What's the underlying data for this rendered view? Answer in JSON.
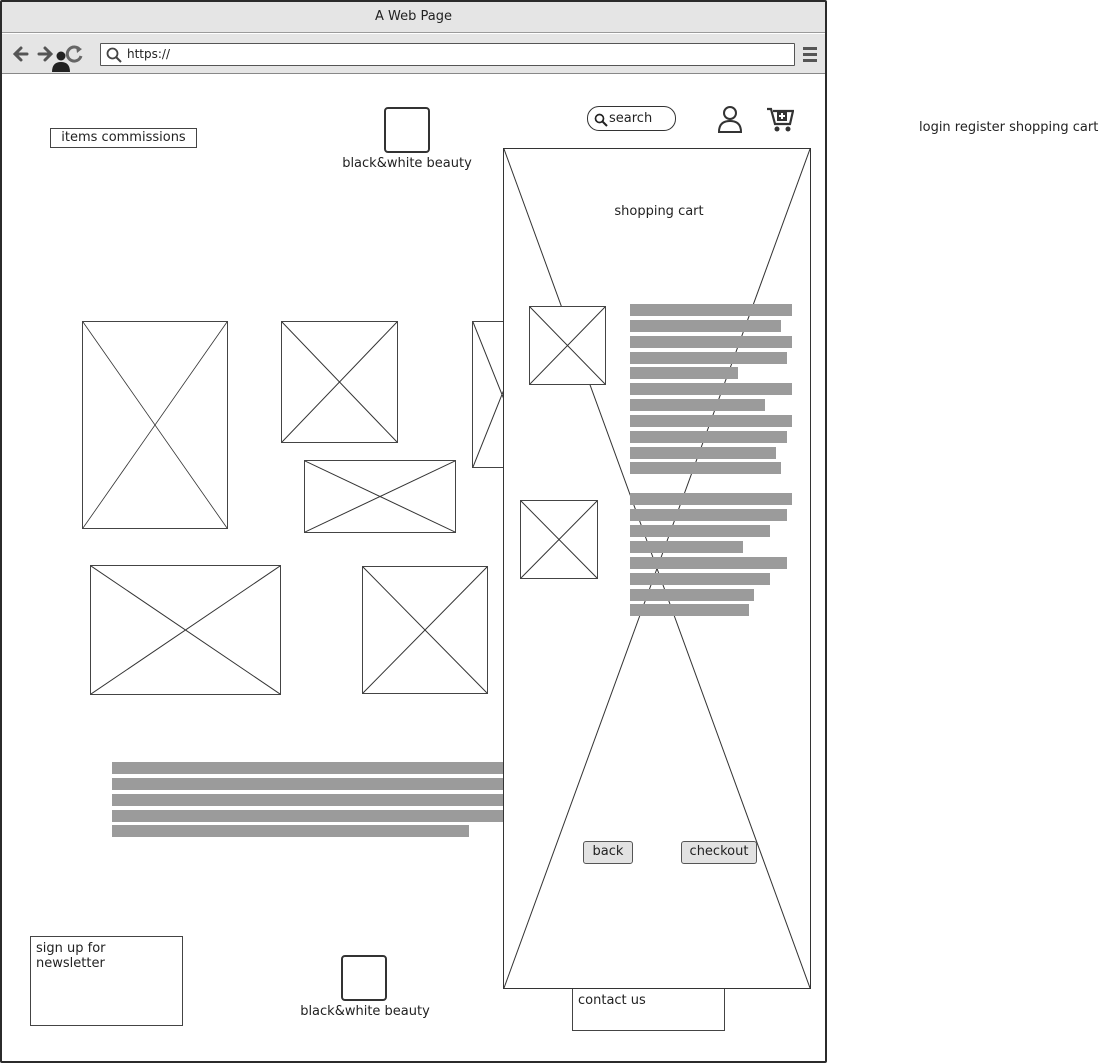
{
  "window": {
    "title": "A Web Page"
  },
  "browser": {
    "url": "https://"
  },
  "header": {
    "nav_button": "items commissions",
    "logo_text": "black&white beauty",
    "search_placeholder": "search"
  },
  "annotation": "login register shopping cart",
  "cart": {
    "title": "shopping cart",
    "back_label": "back",
    "checkout_label": "checkout"
  },
  "footer": {
    "newsletter_label": "sign up for newsletter",
    "logo_text": "black&white beauty",
    "contact_label": "contact us"
  },
  "icons": {
    "back": "arrow-left-icon",
    "forward": "arrow-right-icon",
    "user": "user-icon",
    "reload": "reload-icon",
    "menu": "hamburger-menu-icon",
    "search": "search-icon",
    "cart": "cart-add-icon"
  }
}
